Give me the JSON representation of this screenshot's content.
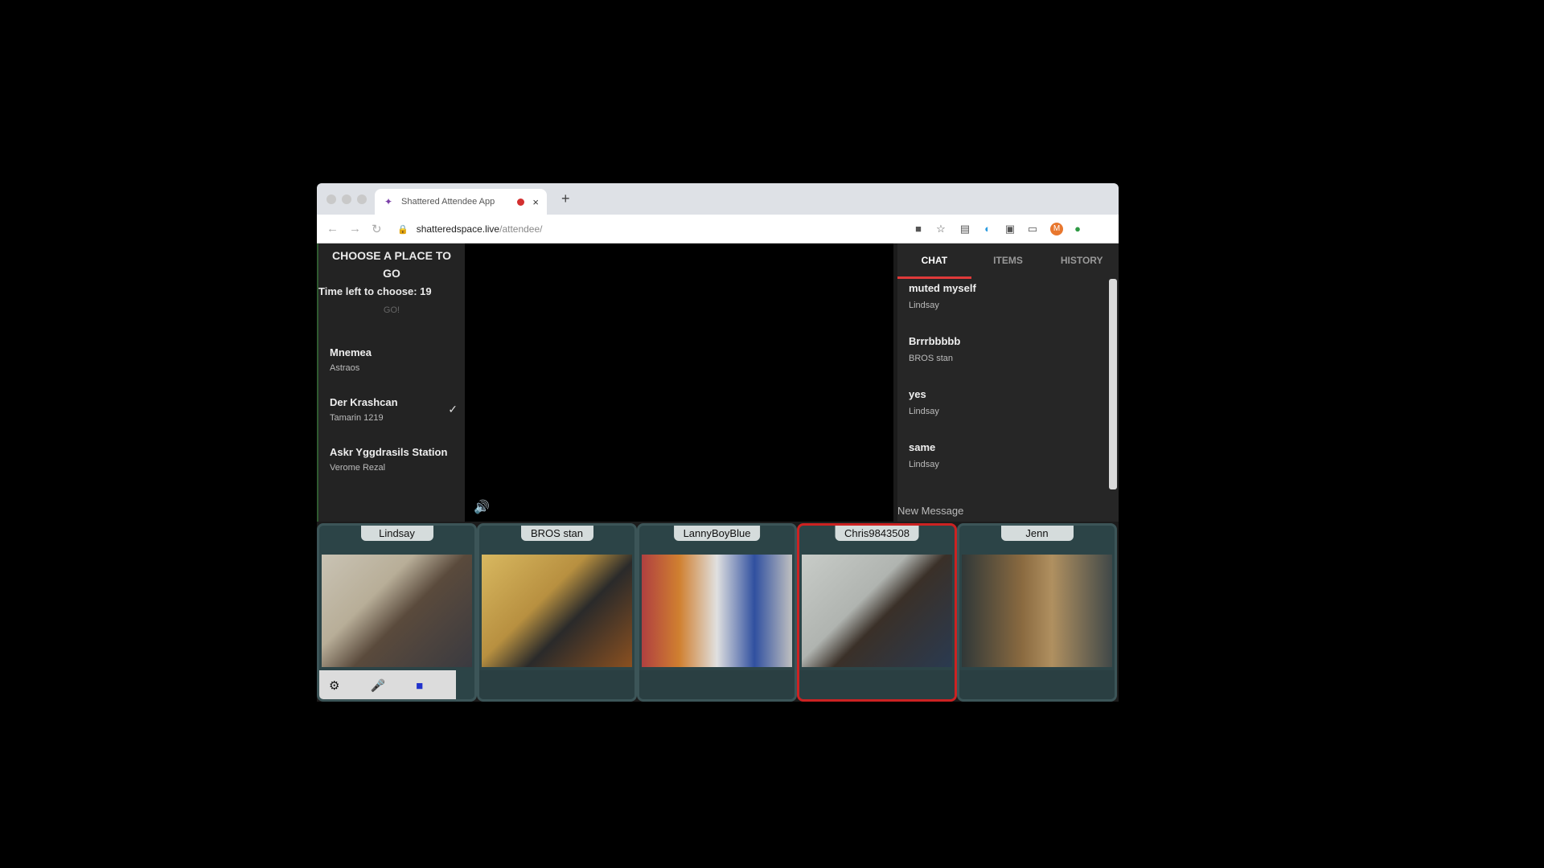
{
  "browser": {
    "tab_title": "Shattered Attendee App",
    "close_tab": "×",
    "new_tab": "+",
    "url_host": "shatteredspace.live",
    "url_path": "/attendee/",
    "profile_initial": "M"
  },
  "left_panel": {
    "title": "CHOOSE A PLACE TO GO",
    "timer": "Time left to choose: 19",
    "go_label": "GO!",
    "places": [
      {
        "name": "Mnemea",
        "sub": "Astraos",
        "selected": false
      },
      {
        "name": "Der Krashcan",
        "sub": "Tamarin 1219",
        "selected": true
      },
      {
        "name": "Askr Yggdrasils Station",
        "sub": "Verome Rezal",
        "selected": false
      }
    ]
  },
  "chat": {
    "tabs": [
      "CHAT",
      "ITEMS",
      "HISTORY"
    ],
    "active_tab": "CHAT",
    "messages": [
      {
        "text": "muted myself",
        "author": "Lindsay"
      },
      {
        "text": "Brrrbbbbb",
        "author": "BROS stan"
      },
      {
        "text": "yes",
        "author": "Lindsay"
      },
      {
        "text": "same",
        "author": "Lindsay"
      }
    ],
    "new_message_label": "New Message"
  },
  "participants": [
    {
      "name": "Lindsay",
      "speaking": false
    },
    {
      "name": "BROS stan",
      "speaking": false
    },
    {
      "name": "LannyBoyBlue",
      "speaking": false
    },
    {
      "name": "Chris9843508",
      "speaking": true
    },
    {
      "name": "Jenn",
      "speaking": false
    }
  ],
  "icons": {
    "speaker": "speaker-icon",
    "settings": "gear-icon",
    "mic": "microphone-muted-icon",
    "camera": "camera-icon"
  },
  "colors": {
    "accent": "#e03a3a",
    "speaking_border": "#cc2222",
    "tile_bg": "#2c4447"
  }
}
